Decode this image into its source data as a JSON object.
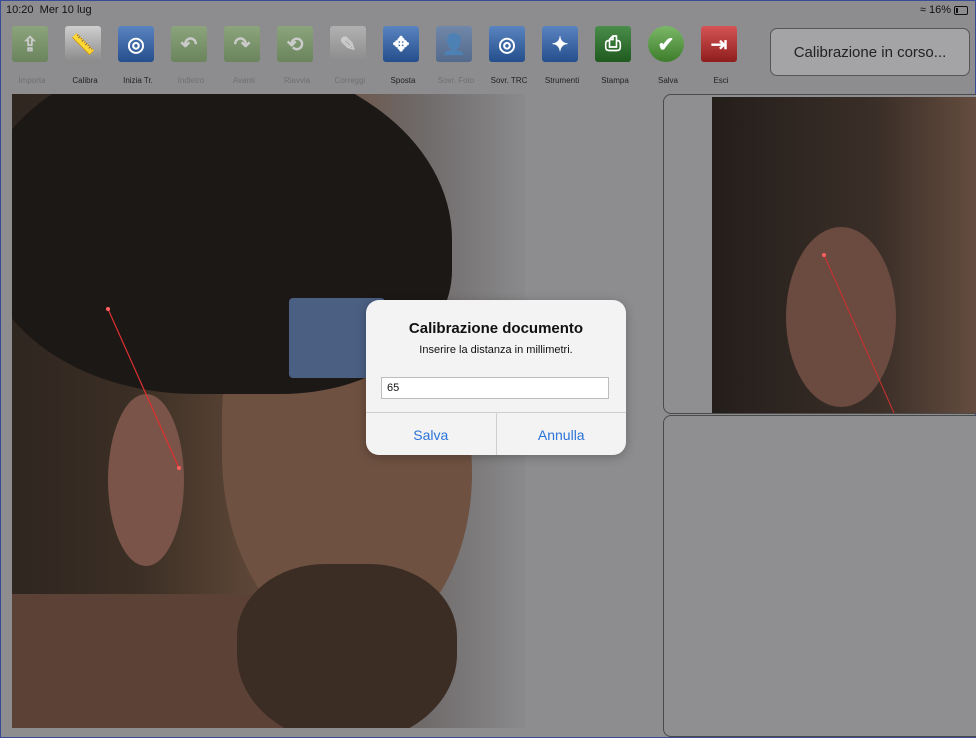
{
  "status": {
    "time": "10:20",
    "date": "Mer 10 lug",
    "battery": "16%"
  },
  "toolbar": [
    {
      "label": "Importa",
      "icon": "import-icon",
      "style": "green",
      "dim": true,
      "glyph": "⇪"
    },
    {
      "label": "Calibra",
      "icon": "ruler-icon",
      "style": "gray",
      "dim": false,
      "glyph": "📏"
    },
    {
      "label": "Inizia Tr.",
      "icon": "start-trace-icon",
      "style": "blue",
      "dim": false,
      "glyph": "◎"
    },
    {
      "label": "Indietro",
      "icon": "undo-icon",
      "style": "green",
      "dim": true,
      "glyph": "↶"
    },
    {
      "label": "Avanti",
      "icon": "redo-icon",
      "style": "green",
      "dim": true,
      "glyph": "↷"
    },
    {
      "label": "Riavvia",
      "icon": "restart-icon",
      "style": "green",
      "dim": true,
      "glyph": "⟲"
    },
    {
      "label": "Correggi",
      "icon": "correct-icon",
      "style": "gray",
      "dim": true,
      "glyph": "✎"
    },
    {
      "label": "Sposta",
      "icon": "move-icon",
      "style": "blue",
      "dim": false,
      "glyph": "✥"
    },
    {
      "label": "Sovr. Foto",
      "icon": "photo-overlay-icon",
      "style": "blue",
      "dim": true,
      "glyph": "👤"
    },
    {
      "label": "Sovr. TRC",
      "icon": "trace-overlay-icon",
      "style": "blue",
      "dim": false,
      "glyph": "◎"
    },
    {
      "label": "Strumenti",
      "icon": "tools-icon",
      "style": "blue",
      "dim": false,
      "glyph": "✦"
    },
    {
      "label": "Stampa",
      "icon": "print-icon",
      "style": "print",
      "dim": false,
      "glyph": "⎙"
    },
    {
      "label": "Salva",
      "icon": "save-check-icon",
      "style": "save",
      "dim": false,
      "glyph": "✔"
    },
    {
      "label": "Esci",
      "icon": "exit-icon",
      "style": "exit",
      "dim": false,
      "glyph": "⇥"
    }
  ],
  "calibration_status": "Calibrazione in corso...",
  "dialog": {
    "title": "Calibrazione documento",
    "message": "Inserire la distanza in millimetri.",
    "input_value": "65",
    "save_label": "Salva",
    "cancel_label": "Annulla"
  }
}
